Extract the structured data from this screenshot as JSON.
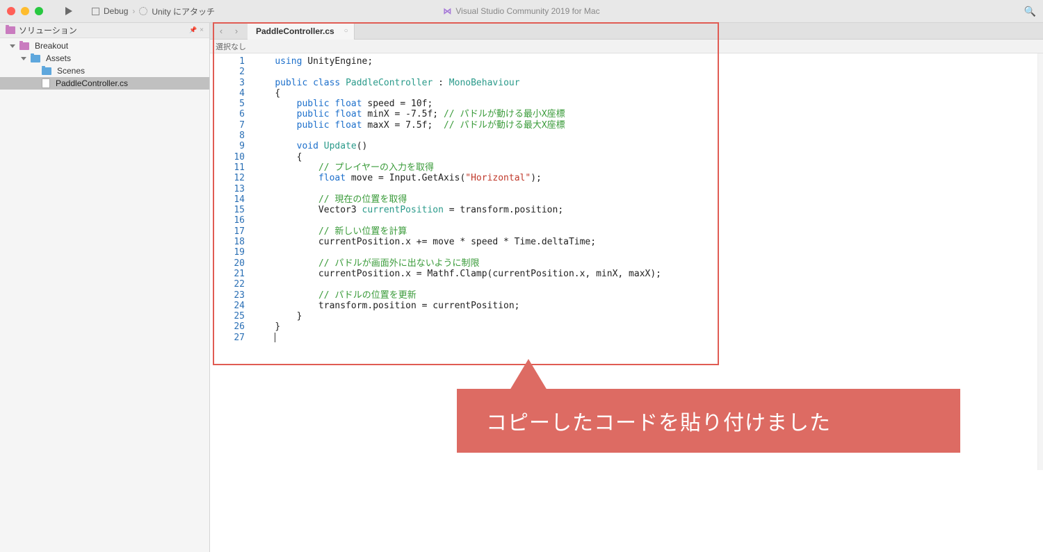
{
  "toolbar": {
    "debug_label": "Debug",
    "attach_label": "Unity にアタッチ",
    "app_title": "Visual Studio Community 2019 for Mac"
  },
  "sidebar": {
    "header_title": "ソリューション",
    "items": [
      {
        "label": "Breakout",
        "level": 0,
        "type": "app",
        "expanded": true
      },
      {
        "label": "Assets",
        "level": 1,
        "type": "folder",
        "expanded": true
      },
      {
        "label": "Scenes",
        "level": 2,
        "type": "folder",
        "expanded": false
      },
      {
        "label": "PaddleController.cs",
        "level": 2,
        "type": "cs",
        "selected": true
      }
    ]
  },
  "editor": {
    "tab_name": "PaddleController.cs",
    "breadcrumb": "選択なし",
    "code_lines": [
      {
        "n": 1,
        "tokens": [
          [
            "kw",
            "using"
          ],
          [
            "",
            " UnityEngine;"
          ]
        ]
      },
      {
        "n": 2,
        "tokens": []
      },
      {
        "n": 3,
        "tokens": [
          [
            "kw",
            "public"
          ],
          [
            "",
            " "
          ],
          [
            "kw",
            "class"
          ],
          [
            "",
            " "
          ],
          [
            "type",
            "PaddleController"
          ],
          [
            "",
            " : "
          ],
          [
            "type",
            "MonoBehaviour"
          ]
        ]
      },
      {
        "n": 4,
        "tokens": [
          [
            "",
            "{"
          ]
        ]
      },
      {
        "n": 5,
        "tokens": [
          [
            "",
            "    "
          ],
          [
            "kw",
            "public"
          ],
          [
            "",
            " "
          ],
          [
            "kw",
            "float"
          ],
          [
            "",
            " speed = 10f;"
          ]
        ]
      },
      {
        "n": 6,
        "tokens": [
          [
            "",
            "    "
          ],
          [
            "kw",
            "public"
          ],
          [
            "",
            " "
          ],
          [
            "kw",
            "float"
          ],
          [
            "",
            " minX = -7.5f; "
          ],
          [
            "cmt",
            "// パドルが動ける最小X座標"
          ]
        ]
      },
      {
        "n": 7,
        "tokens": [
          [
            "",
            "    "
          ],
          [
            "kw",
            "public"
          ],
          [
            "",
            " "
          ],
          [
            "kw",
            "float"
          ],
          [
            "",
            " maxX = 7.5f;  "
          ],
          [
            "cmt",
            "// パドルが動ける最大X座標"
          ]
        ]
      },
      {
        "n": 8,
        "tokens": []
      },
      {
        "n": 9,
        "tokens": [
          [
            "",
            "    "
          ],
          [
            "kw",
            "void"
          ],
          [
            "",
            " "
          ],
          [
            "type",
            "Update"
          ],
          [
            "",
            "()"
          ]
        ]
      },
      {
        "n": 10,
        "tokens": [
          [
            "",
            "    {"
          ]
        ]
      },
      {
        "n": 11,
        "tokens": [
          [
            "",
            "        "
          ],
          [
            "cmt",
            "// プレイヤーの入力を取得"
          ]
        ]
      },
      {
        "n": 12,
        "tokens": [
          [
            "",
            "        "
          ],
          [
            "kw",
            "float"
          ],
          [
            "",
            " move = Input.GetAxis("
          ],
          [
            "str",
            "\"Horizontal\""
          ],
          [
            "",
            ");"
          ]
        ]
      },
      {
        "n": 13,
        "tokens": []
      },
      {
        "n": 14,
        "tokens": [
          [
            "",
            "        "
          ],
          [
            "cmt",
            "// 現在の位置を取得"
          ]
        ]
      },
      {
        "n": 15,
        "tokens": [
          [
            "",
            "        Vector3 "
          ],
          [
            "type",
            "currentPosition"
          ],
          [
            "",
            " = transform.position;"
          ]
        ]
      },
      {
        "n": 16,
        "tokens": []
      },
      {
        "n": 17,
        "tokens": [
          [
            "",
            "        "
          ],
          [
            "cmt",
            "// 新しい位置を計算"
          ]
        ]
      },
      {
        "n": 18,
        "tokens": [
          [
            "",
            "        currentPosition.x += move * speed * Time.deltaTime;"
          ]
        ]
      },
      {
        "n": 19,
        "tokens": []
      },
      {
        "n": 20,
        "tokens": [
          [
            "",
            "        "
          ],
          [
            "cmt",
            "// パドルが画面外に出ないように制限"
          ]
        ]
      },
      {
        "n": 21,
        "tokens": [
          [
            "",
            "        currentPosition.x = Mathf.Clamp(currentPosition.x, minX, maxX);"
          ]
        ]
      },
      {
        "n": 22,
        "tokens": []
      },
      {
        "n": 23,
        "tokens": [
          [
            "",
            "        "
          ],
          [
            "cmt",
            "// パドルの位置を更新"
          ]
        ]
      },
      {
        "n": 24,
        "tokens": [
          [
            "",
            "        transform.position = currentPosition;"
          ]
        ]
      },
      {
        "n": 25,
        "tokens": [
          [
            "",
            "    }"
          ]
        ]
      },
      {
        "n": 26,
        "tokens": [
          [
            "",
            "}"
          ]
        ]
      },
      {
        "n": 27,
        "tokens": [
          [
            "cursor",
            ""
          ]
        ]
      }
    ]
  },
  "annotation": {
    "callout_text": "コピーしたコードを貼り付けました"
  }
}
